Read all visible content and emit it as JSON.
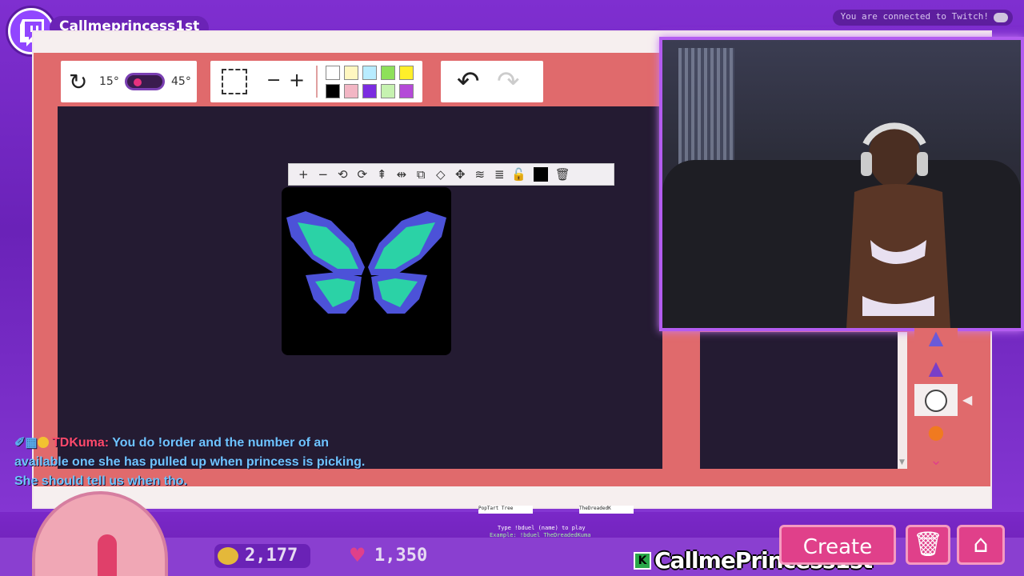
{
  "header": {
    "channel_name": "Callmeprincess1st",
    "connection_status": "You are connected to Twitch!"
  },
  "rotation_toolbar": {
    "min_label": "15°",
    "max_label": "45°"
  },
  "edit_toolbar": {
    "zoom_out_label": "−",
    "zoom_in_label": "+",
    "palette": [
      "#ffffff",
      "#fff7c0",
      "#b8ecff",
      "#8ee05a",
      "#ffef2a",
      "#000000",
      "#f2b6c4",
      "#7b2ce0",
      "#c6f2b0",
      "#b44ad8"
    ]
  },
  "history_toolbar": {
    "undo_icon": "undo-icon",
    "redo_icon": "redo-icon"
  },
  "object_toolbar": {
    "buttons": [
      "+",
      "−",
      "⟲",
      "⟳",
      "⇞",
      "⇹",
      "⧉",
      "◇",
      "✥",
      "≋",
      "≣",
      "🔓"
    ],
    "color": "#000000",
    "delete_icon": "trash-icon"
  },
  "artwork": {
    "subject": "butterfly-wings"
  },
  "side_icons": [
    "hat-blue",
    "witch-hat",
    "circle",
    "pumpkin",
    "chevron-down"
  ],
  "chat": {
    "username": "TDKuma:",
    "message": "You do !order and the number of an available one she has pulled up when princess is picking. She should tell us when tho."
  },
  "stats": {
    "coins": "2,177",
    "hearts": "1,350"
  },
  "duel": {
    "player1": "PopTart Tree",
    "player2": "TheDreadedK",
    "instruction": "Type !bduel (name) to play",
    "example": "Example: !bduel TheDreadedKuma"
  },
  "brand_name": "CallmePrincess1st",
  "buttons": {
    "create": "Create"
  },
  "colors": {
    "board": "#e06a6c",
    "canvas": "#241b32",
    "accent": "#e0408a",
    "twitch": "#9146ff"
  }
}
